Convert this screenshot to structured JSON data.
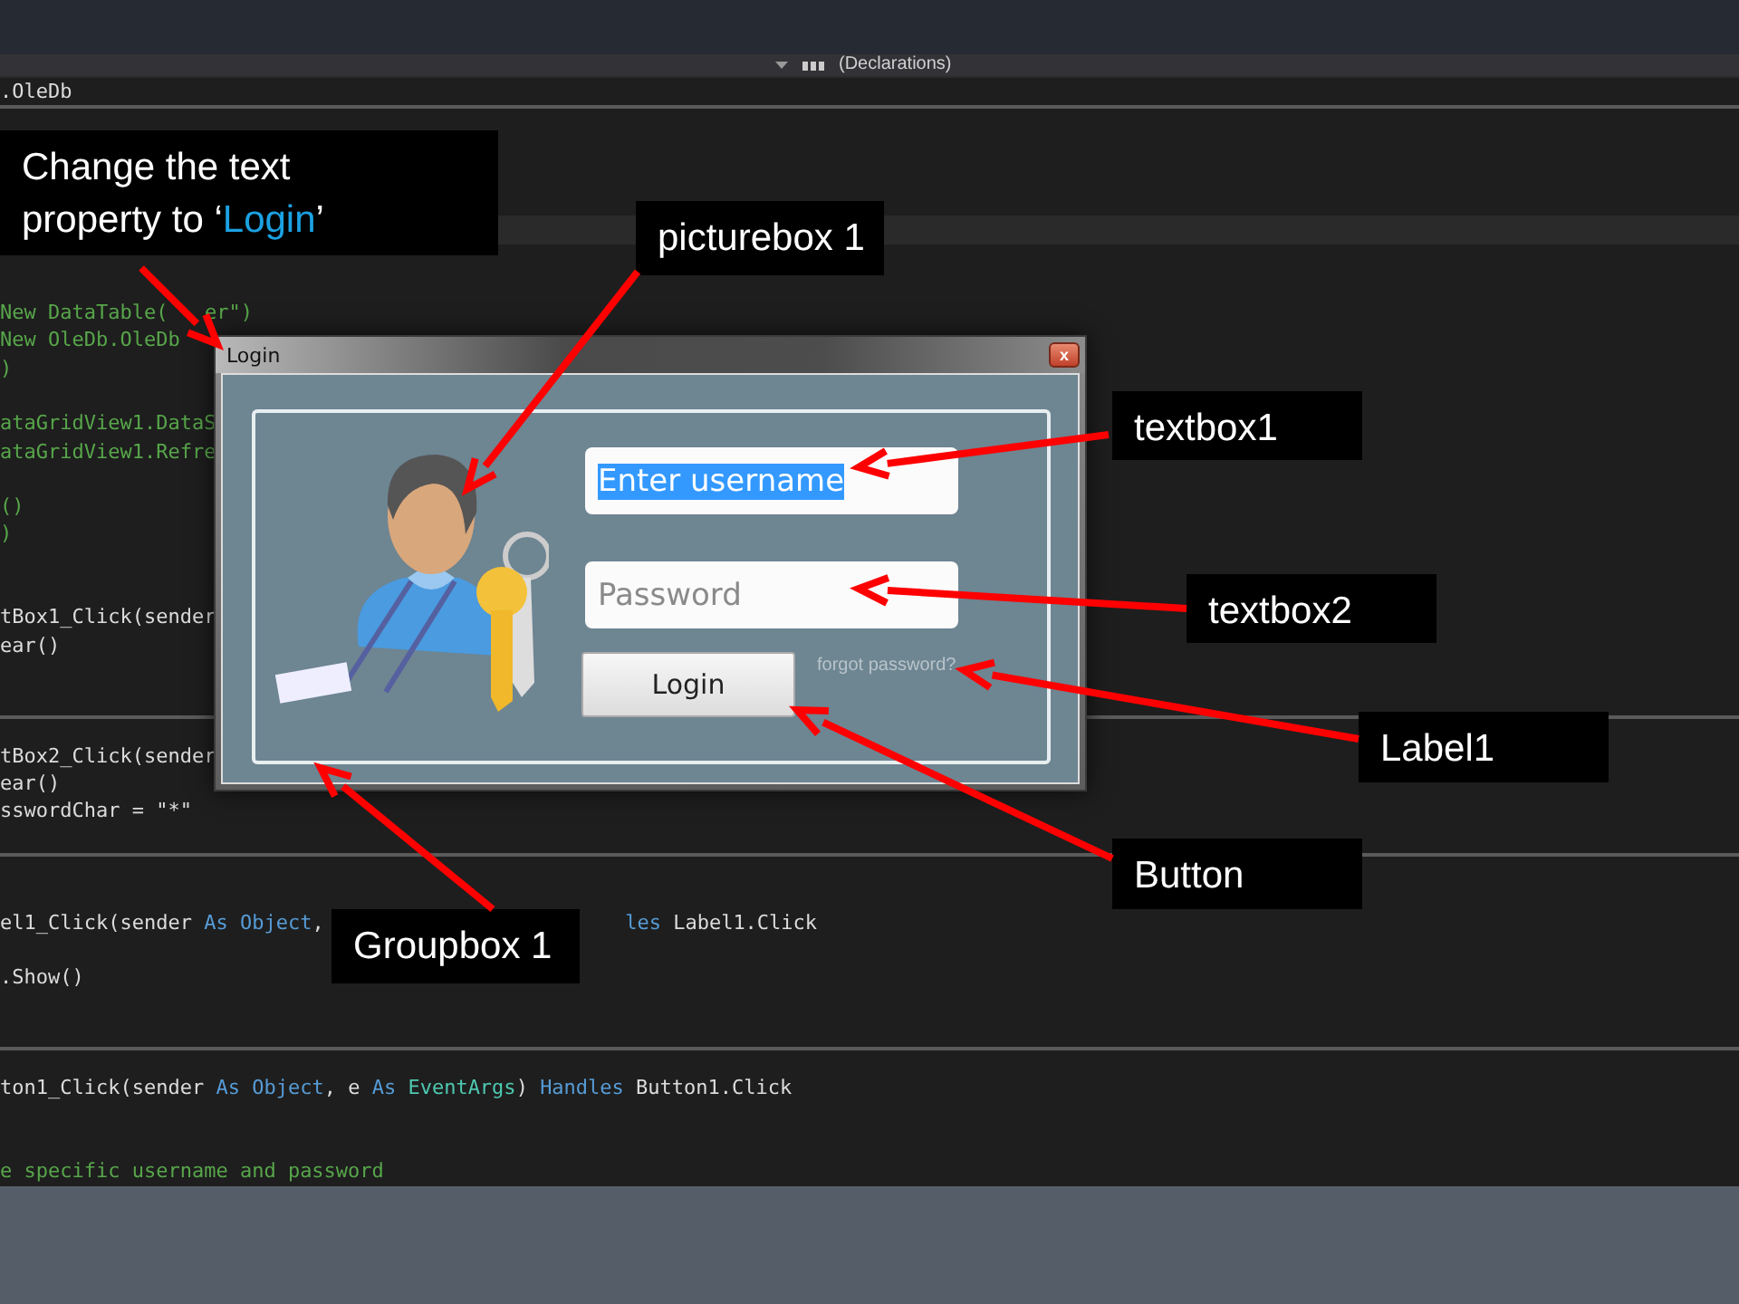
{
  "navbar": {
    "member_dropdown": "(Declarations)"
  },
  "code_lines": [
    {
      "segments": [
        {
          "t": ".OleDb",
          "kind": "plain"
        }
      ]
    },
    {
      "segments": [
        {
          "t": "New DataTable(",
          "kind": "comment"
        }
      ],
      "tail": [
        {
          "t": "er\")",
          "kind": "comment"
        }
      ]
    },
    {
      "segments": [
        {
          "t": "New OleDb.OleDb",
          "kind": "comment"
        }
      ]
    },
    {
      "segments": [
        {
          "t": ")",
          "kind": "comment"
        }
      ]
    },
    {
      "segments": [
        {
          "t": "ataGridView1.DataS",
          "kind": "comment"
        }
      ]
    },
    {
      "segments": [
        {
          "t": "ataGridView1.Refre",
          "kind": "comment"
        }
      ]
    },
    {
      "segments": [
        {
          "t": "()",
          "kind": "comment"
        }
      ]
    },
    {
      "segments": [
        {
          "t": ")",
          "kind": "comment"
        }
      ]
    },
    {
      "segments": [
        {
          "t": "tBox1_Click(sender",
          "kind": "plain"
        }
      ]
    },
    {
      "segments": [
        {
          "t": "ear()",
          "kind": "plain"
        }
      ]
    },
    {
      "segments": [
        {
          "t": "tBox2_Click(sender",
          "kind": "plain"
        }
      ]
    },
    {
      "segments": [
        {
          "t": "ear()",
          "kind": "plain"
        }
      ]
    },
    {
      "segments": [
        {
          "t": "sswordChar = \"*\"",
          "kind": "plain"
        }
      ]
    },
    {
      "segments": [
        {
          "t": "el1_Click(sender ",
          "kind": "plain"
        },
        {
          "t": "As",
          "kind": "keyword"
        },
        {
          "t": " Object",
          "kind": "keyword"
        },
        {
          "t": ",",
          "kind": "plain"
        }
      ],
      "tail": [
        {
          "t": "les",
          "kind": "keyword"
        },
        {
          "t": " Label1.Click",
          "kind": "plain"
        }
      ]
    },
    {
      "segments": [
        {
          "t": ".Show()",
          "kind": "plain"
        }
      ]
    },
    {
      "segments": [
        {
          "t": "ton1_Click(sender ",
          "kind": "plain"
        },
        {
          "t": "As",
          "kind": "keyword"
        },
        {
          "t": " Object",
          "kind": "keyword"
        },
        {
          "t": ", e ",
          "kind": "plain"
        },
        {
          "t": "As",
          "kind": "keyword"
        },
        {
          "t": " EventArgs",
          "kind": "type"
        },
        {
          "t": ") ",
          "kind": "plain"
        },
        {
          "t": "Handles",
          "kind": "keyword"
        },
        {
          "t": " Button1.Click",
          "kind": "plain"
        }
      ]
    },
    {
      "segments": [
        {
          "t": "e specific username and password",
          "kind": "comment"
        }
      ]
    }
  ],
  "dialog": {
    "title": "Login",
    "close": "x",
    "textbox1": {
      "value": "Enter username",
      "text_selected": true
    },
    "textbox2": {
      "placeholder": "Password"
    },
    "button": "Login",
    "label1": "forgot password?"
  },
  "callouts": [
    {
      "before": "Change the text property to ‘",
      "highlight": "Login",
      "after": "’"
    },
    {
      "before": "picturebox 1"
    },
    {
      "before": "textbox1"
    },
    {
      "before": "textbox2"
    },
    {
      "before": "Label1"
    },
    {
      "before": "Button"
    },
    {
      "before": "Groupbox 1"
    }
  ]
}
